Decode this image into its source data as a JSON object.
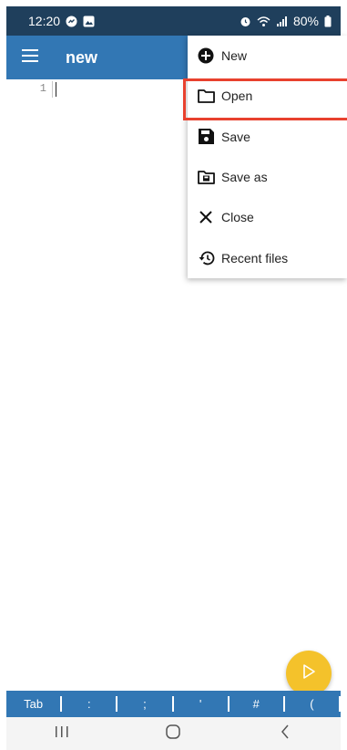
{
  "status_bar": {
    "time": "12:20",
    "battery": "80%",
    "icons": [
      "messenger-icon",
      "gallery-icon",
      "alarm-icon",
      "wifi-icon",
      "signal-icon",
      "battery-icon"
    ]
  },
  "app_bar": {
    "title": "new",
    "menu_icon": "hamburger-icon"
  },
  "editor": {
    "line_numbers": [
      "1"
    ],
    "content": ""
  },
  "dropdown_menu": {
    "items": [
      {
        "label": "New",
        "icon": "plus-circle-icon"
      },
      {
        "label": "Open",
        "icon": "folder-icon",
        "highlighted": true
      },
      {
        "label": "Save",
        "icon": "floppy-icon"
      },
      {
        "label": "Save as",
        "icon": "save-as-folder-icon"
      },
      {
        "label": "Close",
        "icon": "close-icon"
      },
      {
        "label": "Recent files",
        "icon": "history-icon"
      }
    ]
  },
  "fab": {
    "icon": "play-icon"
  },
  "key_bar": {
    "keys": [
      "Tab",
      ":",
      ";",
      "'",
      "#",
      "("
    ]
  },
  "nav_bar": {
    "buttons": [
      "recent-apps-icon",
      "home-icon",
      "back-icon"
    ]
  },
  "colors": {
    "status_bar": "#1f3f5c",
    "app_bar": "#3277b4",
    "highlight_border": "#e8412e",
    "fab": "#f4c22b",
    "nav_bar": "#f4f4f4"
  }
}
